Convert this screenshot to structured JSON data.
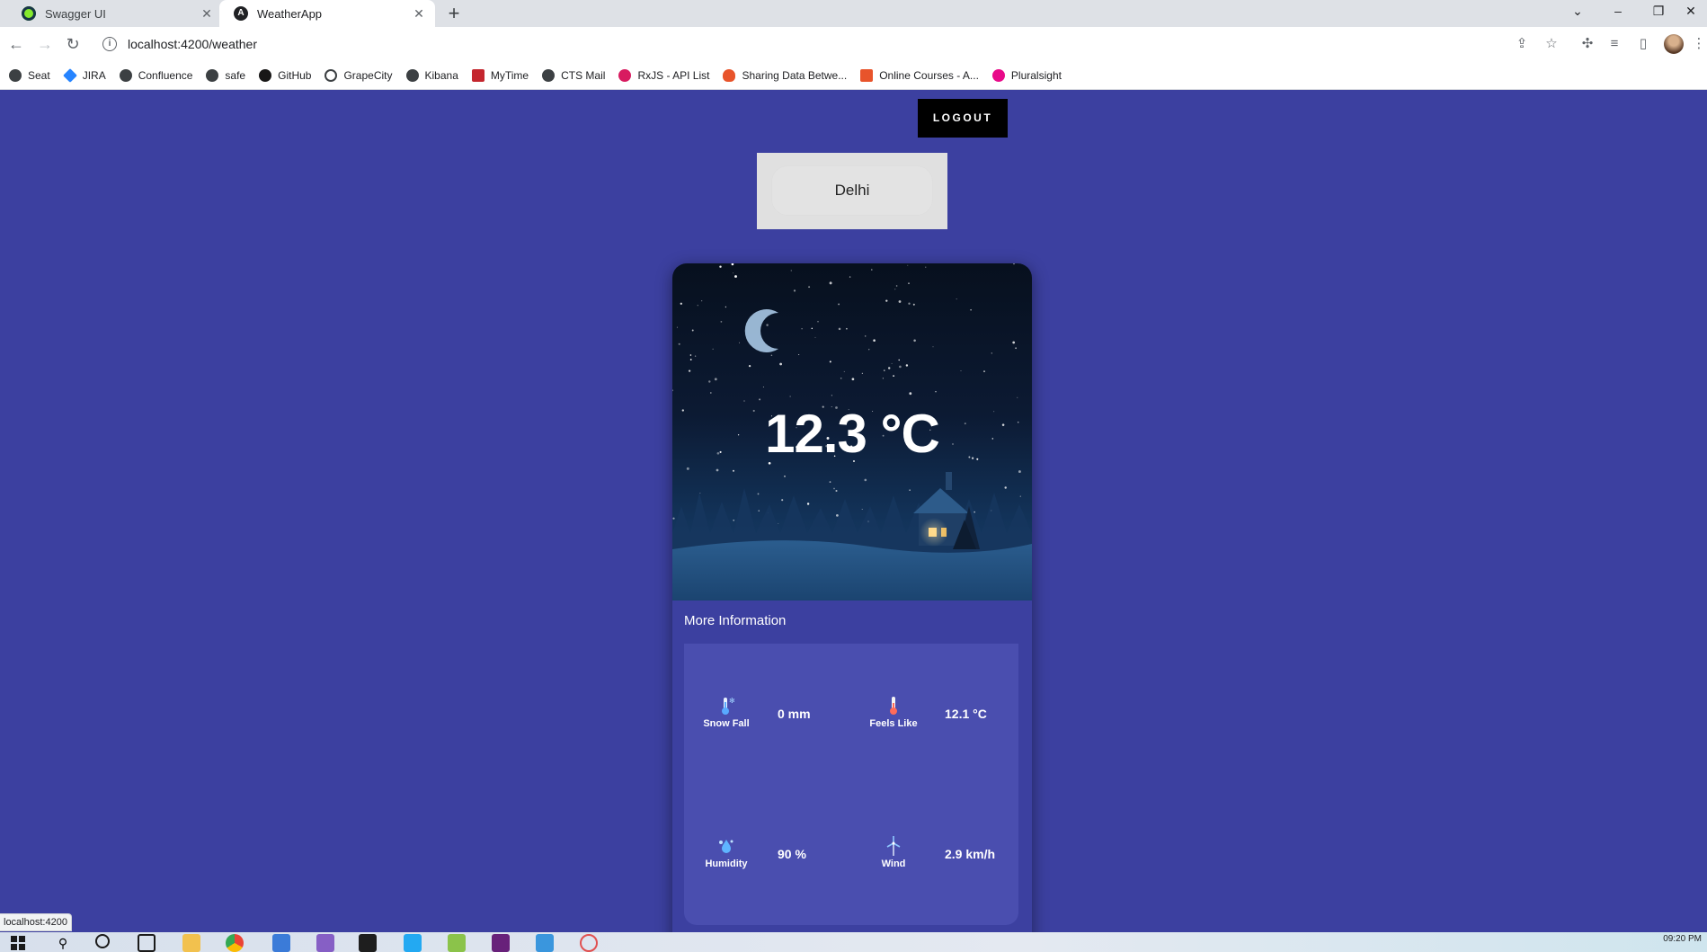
{
  "browser": {
    "tabs": [
      {
        "title": "Swagger UI",
        "icon": "swagger-icon",
        "color": "#85ea2d",
        "active": false
      },
      {
        "title": "WeatherApp",
        "icon": "angular-icon",
        "color": "#202124",
        "active": true
      }
    ],
    "url": "localhost:4200/weather",
    "bookmarks": [
      {
        "label": "Seat",
        "icon": "globe-icon",
        "color": "#3c4043"
      },
      {
        "label": "JIRA",
        "icon": "jira-icon",
        "color": "#2684ff"
      },
      {
        "label": "Confluence",
        "icon": "globe-icon",
        "color": "#3c4043"
      },
      {
        "label": "safe",
        "icon": "globe-icon",
        "color": "#3c4043"
      },
      {
        "label": "GitHub",
        "icon": "github-icon",
        "color": "#181717"
      },
      {
        "label": "GrapeCity",
        "icon": "grapecity-icon",
        "color": "#3c4043"
      },
      {
        "label": "Kibana",
        "icon": "globe-icon",
        "color": "#3c4043"
      },
      {
        "label": "MyTime",
        "icon": "mytime-icon",
        "color": "#c4262e"
      },
      {
        "label": "CTS Mail",
        "icon": "globe-icon",
        "color": "#3c4043"
      },
      {
        "label": "RxJS - API List",
        "icon": "rxjs-icon",
        "color": "#d81b60"
      },
      {
        "label": "Sharing Data Betwe...",
        "icon": "flame-icon",
        "color": "#e8542b"
      },
      {
        "label": "Online Courses - A...",
        "icon": "udemy-icon",
        "color": "#e8542b"
      },
      {
        "label": "Pluralsight",
        "icon": "pluralsight-icon",
        "color": "#e80a89"
      }
    ],
    "status_url": "localhost:4200"
  },
  "app": {
    "logout_label": "LOGOUT",
    "search_value": "Delhi",
    "temperature": "12.3 °C",
    "more_info_title": "More Information",
    "metrics": [
      {
        "label": "Snow Fall",
        "value": "0 mm",
        "icon": "snowfall-thermometer-icon"
      },
      {
        "label": "Feels Like",
        "value": "12.1 °C",
        "icon": "thermometer-icon"
      },
      {
        "label": "Humidity",
        "value": "90 %",
        "icon": "humidity-icon"
      },
      {
        "label": "Wind",
        "value": "2.9 km/h",
        "icon": "wind-turbine-icon"
      }
    ]
  },
  "taskbar": {
    "clock": "09:20 PM"
  },
  "colors": {
    "page_bg": "#3c40a0",
    "panel_bg": "#4a4eaf",
    "logout_bg": "#000000"
  }
}
